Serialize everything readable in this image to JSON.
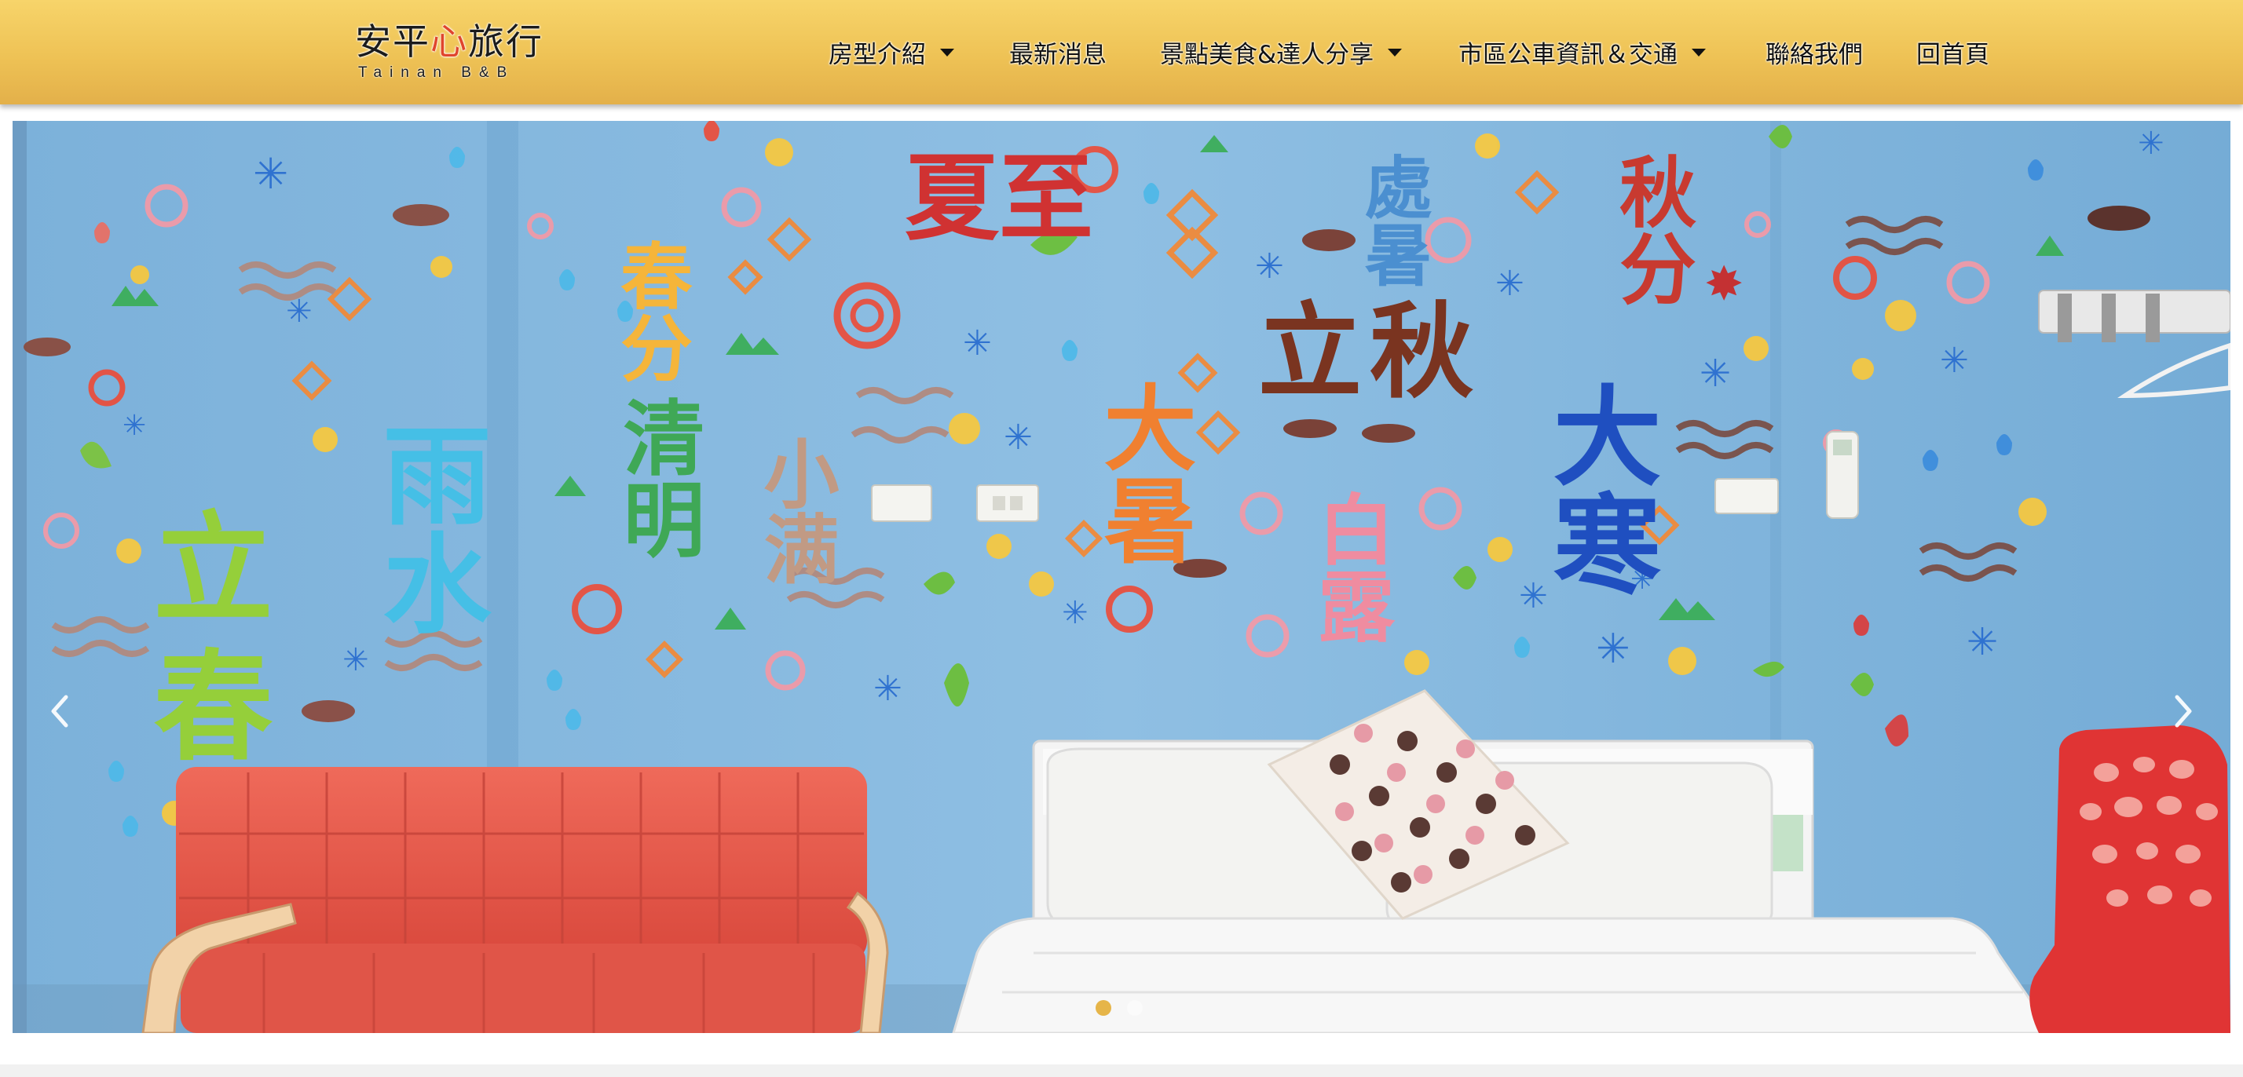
{
  "header": {
    "logo": {
      "prefix": "安平",
      "heart": "心",
      "suffix": "旅行",
      "subtitle": "Tainan B&B"
    },
    "nav": [
      {
        "label": "房型介紹",
        "has_dropdown": true
      },
      {
        "label": "最新消息",
        "has_dropdown": false
      },
      {
        "label": "景點美食&達人分享",
        "has_dropdown": true
      },
      {
        "label": "市區公車資訊＆交通",
        "has_dropdown": true
      },
      {
        "label": "聯絡我們",
        "has_dropdown": false
      },
      {
        "label": "回首頁",
        "has_dropdown": false
      }
    ]
  },
  "slider": {
    "prev_icon": "chevron-left-icon",
    "next_icon": "chevron-right-icon",
    "slide_count": 2,
    "active_index": 0,
    "wall_text": {
      "lichun": "立春",
      "yushui": "雨水",
      "chunfen": "春分",
      "qingming": "清明",
      "xiaoman": "小满",
      "xiazhi": "夏至",
      "dashu": "大暑",
      "liqiu": "立秋",
      "bailu": "白露",
      "dahan": "大寒",
      "qiufen": "秋分",
      "chushu": "處暑"
    }
  },
  "colors": {
    "header_top": "#f7d46a",
    "header_bottom": "#e3b04a",
    "wall_blue": "#7eb4dc",
    "sofa_red": "#e2584a",
    "dot_active": "#e6b549"
  }
}
